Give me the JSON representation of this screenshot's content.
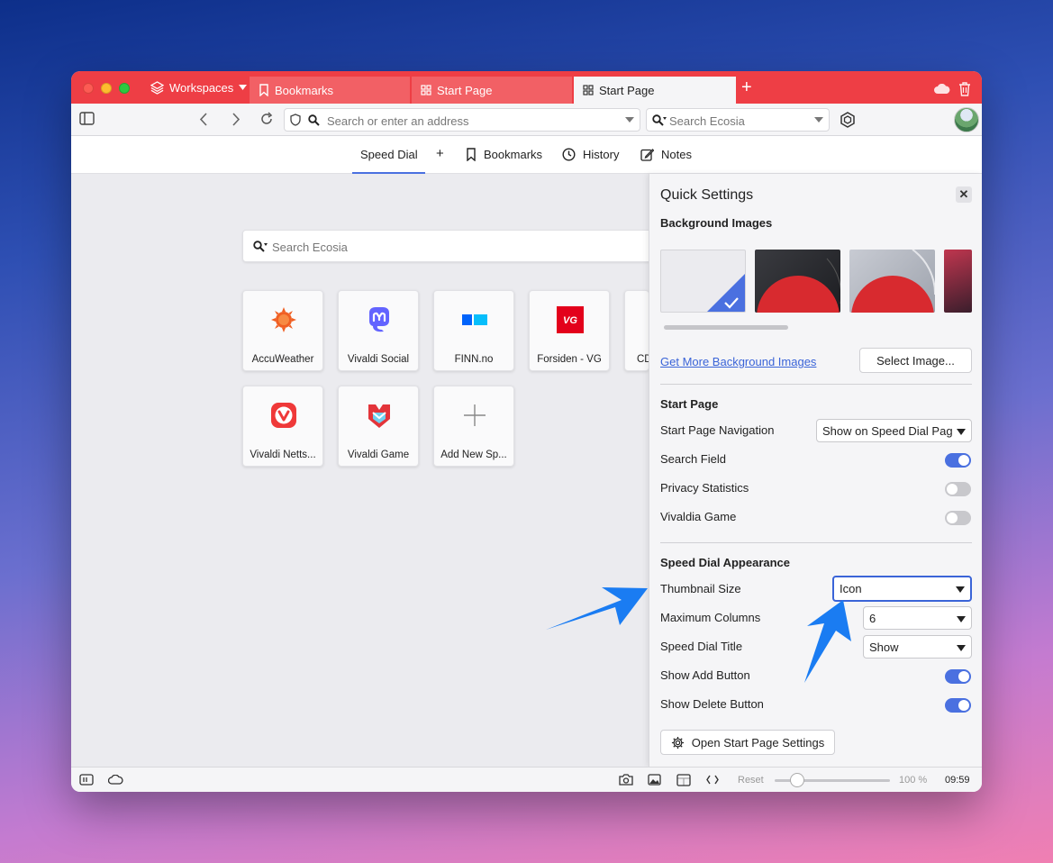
{
  "tabs": {
    "workspaces_label": "Workspaces",
    "items": [
      {
        "label": "Bookmarks"
      },
      {
        "label": "Start Page"
      },
      {
        "label": "Start Page"
      }
    ]
  },
  "toolbar": {
    "address_placeholder": "Search or enter an address",
    "search_placeholder": "Search Ecosia"
  },
  "startpage_nav": {
    "speed_dial": "Speed Dial",
    "add": "+",
    "bookmarks": "Bookmarks",
    "history": "History",
    "notes": "Notes"
  },
  "speed_dial": {
    "search_placeholder": "Search Ecosia",
    "tiles": [
      {
        "label": "AccuWeather",
        "icon": "accuweather-icon"
      },
      {
        "label": "Vivaldi Social",
        "icon": "mastodon-icon"
      },
      {
        "label": "FINN.no",
        "icon": "finn-icon"
      },
      {
        "label": "Forsiden - VG",
        "icon": "vg-icon"
      },
      {
        "label": "CD",
        "icon": "partial-tile"
      },
      {
        "label": "Vivaldi Netts...",
        "icon": "vivaldi-icon"
      },
      {
        "label": "Vivaldi Game",
        "icon": "vivaldi-game-icon"
      },
      {
        "label": "Add New Sp...",
        "icon": "plus-icon"
      }
    ]
  },
  "quick_settings": {
    "title": "Quick Settings",
    "close": "✕",
    "background_heading": "Background Images",
    "get_more_link": "Get More Background Images",
    "select_image_button": "Select Image...",
    "start_page_heading": "Start Page",
    "start_page_navigation_label": "Start Page Navigation",
    "start_page_navigation_value": "Show on Speed Dial Pag",
    "search_field_label": "Search Field",
    "search_field_on": true,
    "privacy_statistics_label": "Privacy Statistics",
    "privacy_statistics_on": false,
    "vivaldia_game_label": "Vivaldia Game",
    "vivaldia_game_on": false,
    "appearance_heading": "Speed Dial Appearance",
    "thumbnail_size_label": "Thumbnail Size",
    "thumbnail_size_value": "Icon",
    "max_columns_label": "Maximum Columns",
    "max_columns_value": "6",
    "speed_dial_title_label": "Speed Dial Title",
    "speed_dial_title_value": "Show",
    "show_add_button_label": "Show Add Button",
    "show_add_button_on": true,
    "show_delete_button_label": "Show Delete Button",
    "show_delete_button_on": true,
    "open_settings_button": "Open Start Page Settings"
  },
  "statusbar": {
    "reset": "Reset",
    "zoom": "100 %",
    "time": "09:59"
  },
  "colors": {
    "accent": "#4a70e0",
    "tabbar": "#ee3e45",
    "annotation_arrow": "#1a7cf2"
  }
}
